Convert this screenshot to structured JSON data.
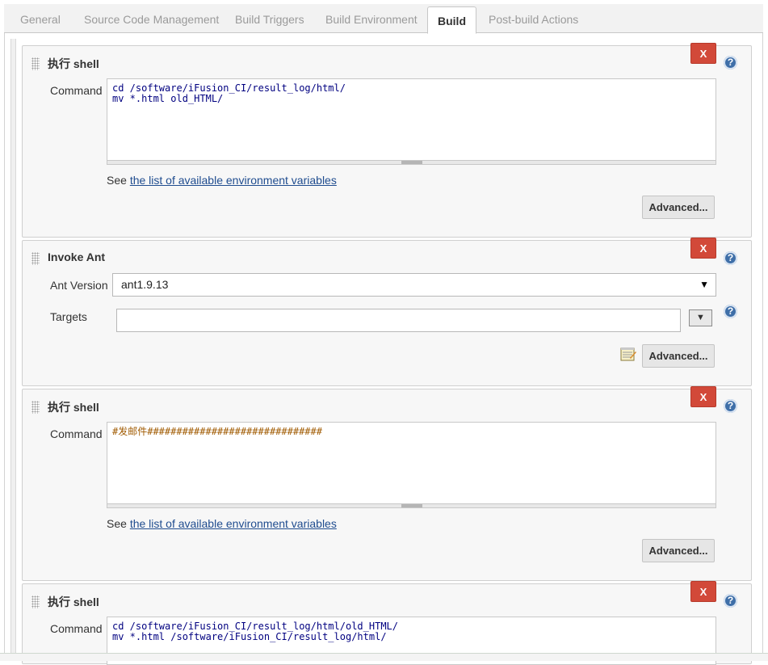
{
  "tabs": [
    {
      "label": "General"
    },
    {
      "label": "Source Code Management"
    },
    {
      "label": "Build Triggers"
    },
    {
      "label": "Build Environment"
    },
    {
      "label": "Build",
      "active": true
    },
    {
      "label": "Post-build Actions"
    }
  ],
  "icons": {
    "delete": "close-x",
    "help": "help-question-icon",
    "notepad": "notepad-icon",
    "grip": "drag-handle-icon"
  },
  "colors": {
    "delete_button": "#d24939",
    "help_icon": "#3f6fa8",
    "link": "#1f4c8f"
  },
  "common": {
    "delete_label": "X",
    "help_label": "?",
    "command_label": "Command",
    "see_prefix": "See",
    "env_link": "the list of available environment variables",
    "advanced_label": "Advanced..."
  },
  "steps": [
    {
      "title": "执行 shell",
      "command": "cd /software/iFusion_CI/result_log/html/\nmv *.html old_HTML/"
    },
    {
      "title": "Invoke Ant",
      "ant_version_label": "Ant Version",
      "ant_version_value": "ant1.9.13",
      "targets_label": "Targets",
      "targets_value": ""
    },
    {
      "title": "执行 shell",
      "command": "#发邮件##############################"
    },
    {
      "title": "执行 shell",
      "command": "cd /software/iFusion_CI/result_log/html/old_HTML/\nmv *.html /software/iFusion_CI/result_log/html/"
    }
  ]
}
